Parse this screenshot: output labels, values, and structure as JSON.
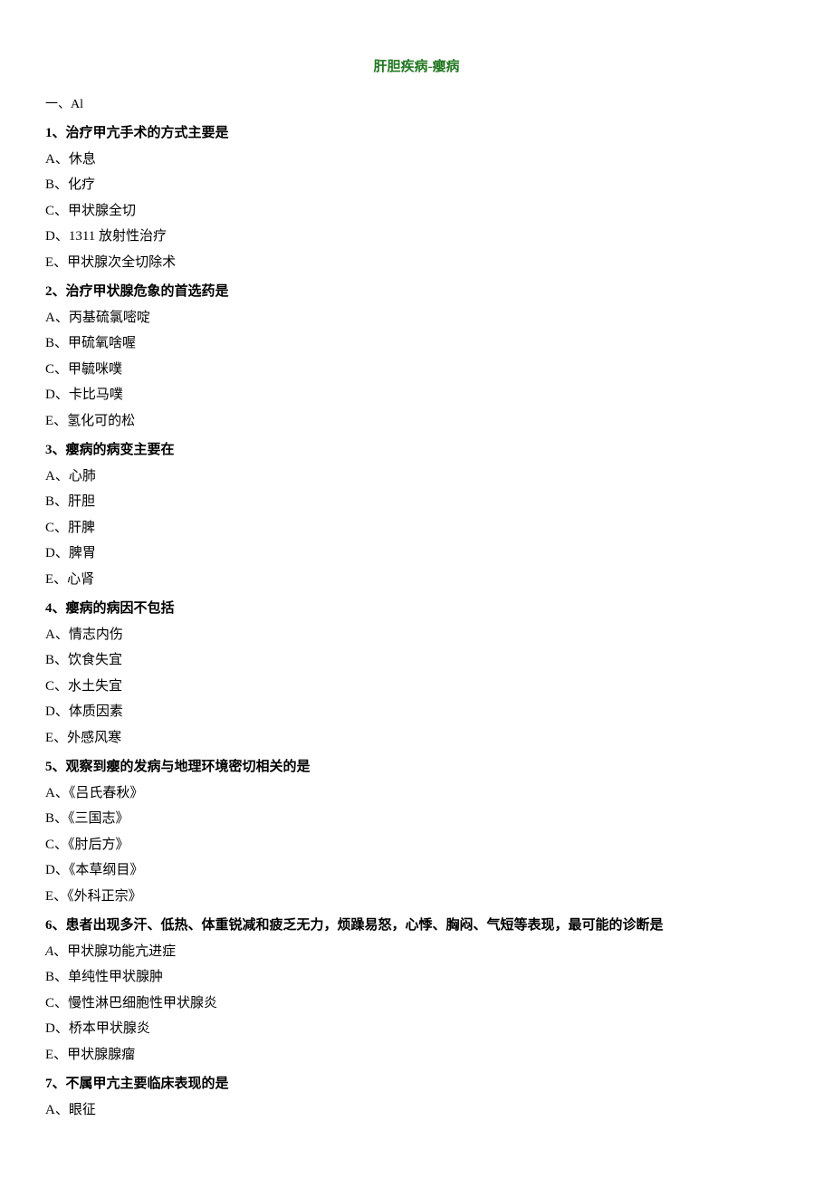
{
  "title": "肝胆疾病-瘿病",
  "sectionLabel": "一、Al",
  "questions": [
    {
      "stem": "1、治疗甲亢手术的方式主要是",
      "options": [
        "A、休息",
        "B、化疗",
        "C、甲状腺全切",
        "D、1311 放射性治疗",
        "E、甲状腺次全切除术"
      ]
    },
    {
      "stem": "2、治疗甲状腺危象的首选药是",
      "options": [
        "A、丙基硫氯嘧啶",
        "B、甲硫氧啥喔",
        "C、甲毓咪噗",
        "D、卡比马噗",
        "E、氢化可的松"
      ]
    },
    {
      "stem": "3、瘿病的病变主要在",
      "options": [
        "A、心肺",
        "B、肝胆",
        "C、肝脾",
        "D、脾胃",
        "E、心肾"
      ]
    },
    {
      "stem": "4、瘿病的病因不包括",
      "options": [
        "A、情志内伤",
        "B、饮食失宜",
        "C、水土失宜",
        "D、体质因素",
        "E、外感风寒"
      ]
    },
    {
      "stem": "5、观察到瘿的发病与地理环境密切相关的是",
      "options": [
        "A、《吕氏春秋》",
        "B、《三国志》",
        "C、《肘后方》",
        "D、《本草纲目》",
        "E、《外科正宗》"
      ]
    },
    {
      "stem": "6、患者出现多汗、低热、体重锐减和疲乏无力，烦躁易怒，心悸、胸闷、气短等表现，最可能的诊断是",
      "options": [
        "A、甲状腺功能亢进症",
        "B、单纯性甲状腺肿",
        "C、慢性淋巴细胞性甲状腺炎",
        "D、桥本甲状腺炎",
        "E、甲状腺腺瘤"
      ]
    },
    {
      "stem": "7、不属甲亢主要临床表现的是",
      "options": [
        "A、眼征"
      ]
    }
  ]
}
